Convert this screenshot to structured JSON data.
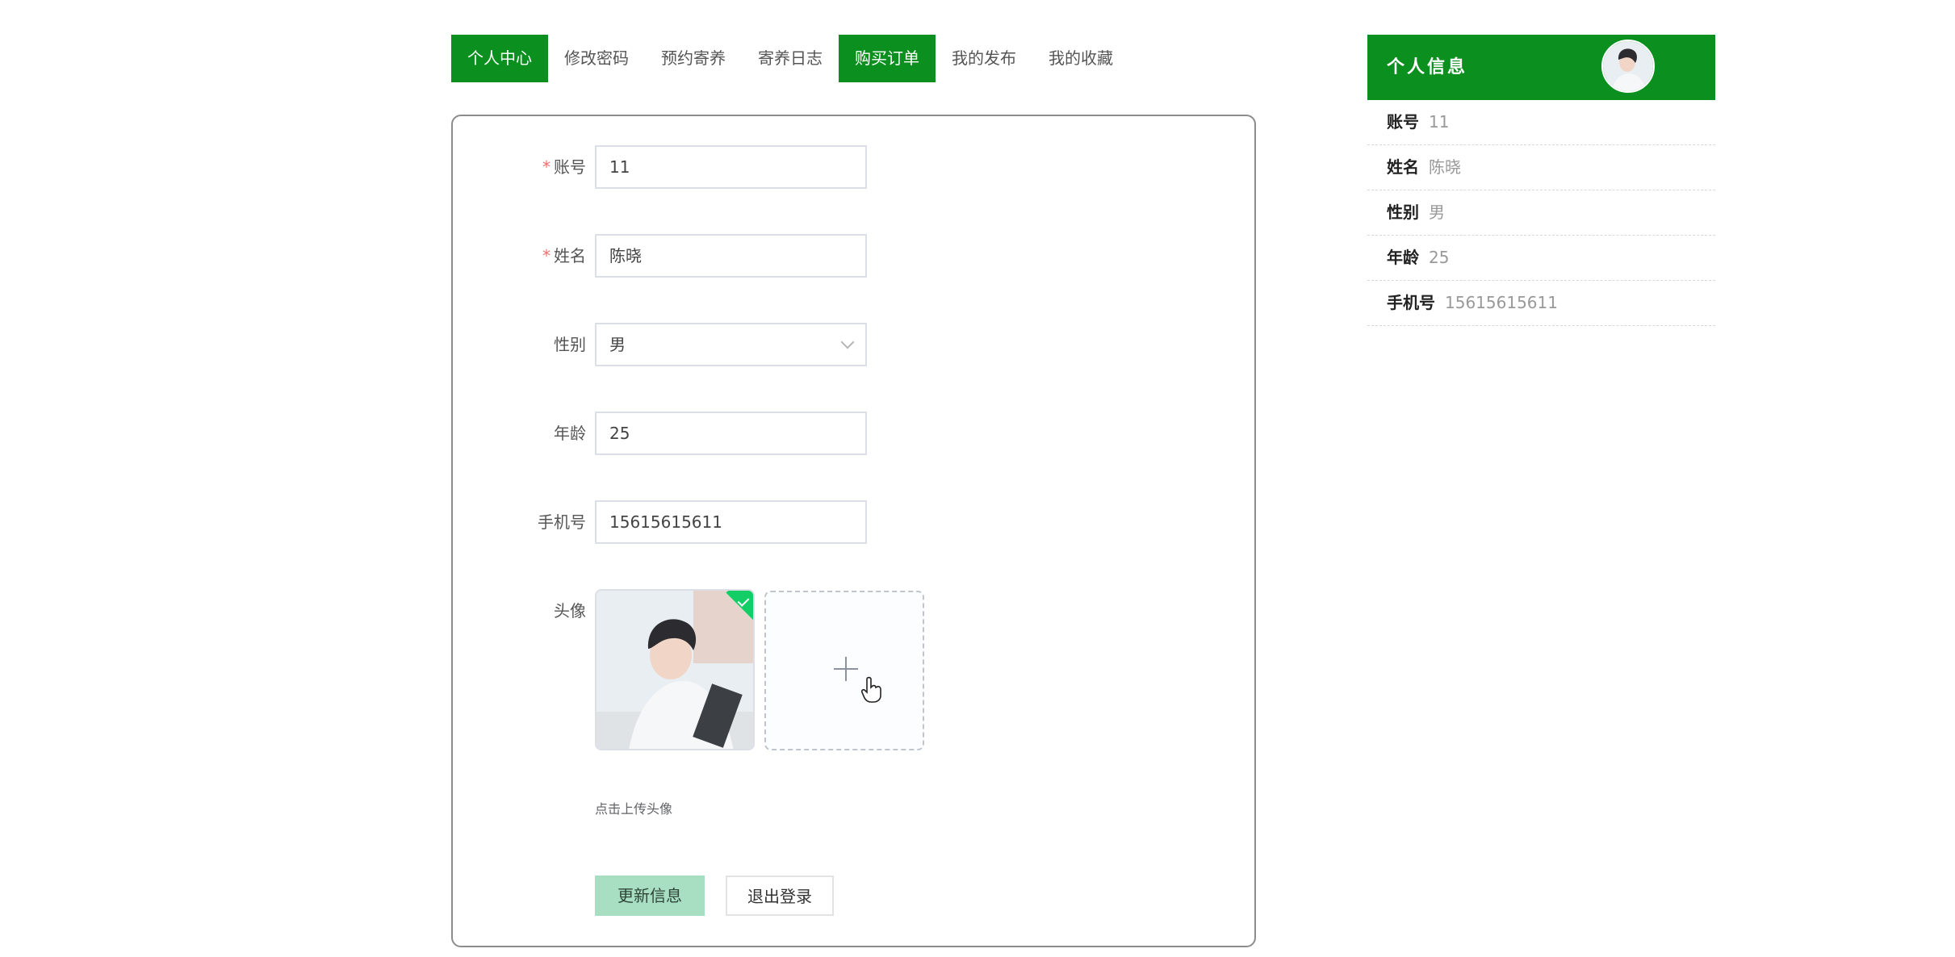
{
  "tabs": [
    {
      "label": "个人中心",
      "active": true
    },
    {
      "label": "修改密码",
      "active": false
    },
    {
      "label": "预约寄养",
      "active": false
    },
    {
      "label": "寄养日志",
      "active": false
    },
    {
      "label": "购买订单",
      "active": true
    },
    {
      "label": "我的发布",
      "active": false
    },
    {
      "label": "我的收藏",
      "active": false
    }
  ],
  "form": {
    "account": {
      "label": "账号",
      "required": "*",
      "value": "11"
    },
    "name": {
      "label": "姓名",
      "required": "*",
      "value": "陈晓"
    },
    "gender": {
      "label": "性别",
      "value": "男"
    },
    "age": {
      "label": "年龄",
      "value": "25"
    },
    "phone": {
      "label": "手机号",
      "value": "15615615611"
    },
    "avatar": {
      "label": "头像",
      "tip": "点击上传头像"
    },
    "update_button": "更新信息",
    "logout_button": "退出登录"
  },
  "profile": {
    "title": "个人信息",
    "rows": [
      {
        "key": "账号",
        "value": "11"
      },
      {
        "key": "姓名",
        "value": "陈晓"
      },
      {
        "key": "性别",
        "value": "男"
      },
      {
        "key": "年龄",
        "value": "25"
      },
      {
        "key": "手机号",
        "value": "15615615611"
      }
    ]
  },
  "colors": {
    "brand_green": "#0b8f1f",
    "update_button": "#a8dfc2",
    "required_star": "#f56c6c"
  },
  "icons": {
    "select_arrow": "chevron-down-icon",
    "upload": "plus-icon",
    "uploaded_success": "check-icon",
    "cursor": "hand-pointer-icon"
  }
}
